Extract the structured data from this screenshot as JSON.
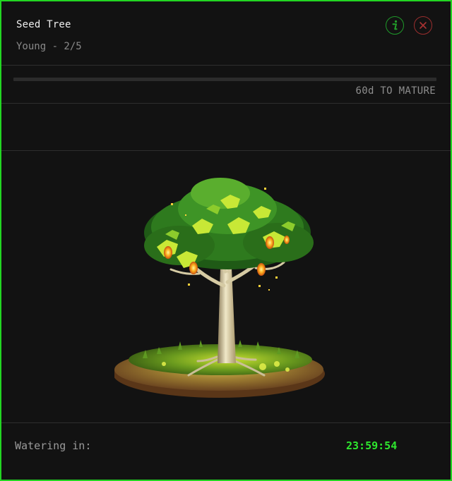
{
  "header": {
    "title": "Seed Tree",
    "stage": "Young - 2/5"
  },
  "actions": {
    "info_icon": "info-icon",
    "close_icon": "close-icon"
  },
  "growth": {
    "mature_label": "60d TO MATURE",
    "progress": 0.0
  },
  "footer": {
    "watering_label": "Watering in:",
    "watering_timer": "23:59:54"
  },
  "colors": {
    "border": "#22d622",
    "timer": "#2ee62e",
    "info": "#1f9a2a",
    "close": "#9a2e2e",
    "background": "#121212"
  }
}
